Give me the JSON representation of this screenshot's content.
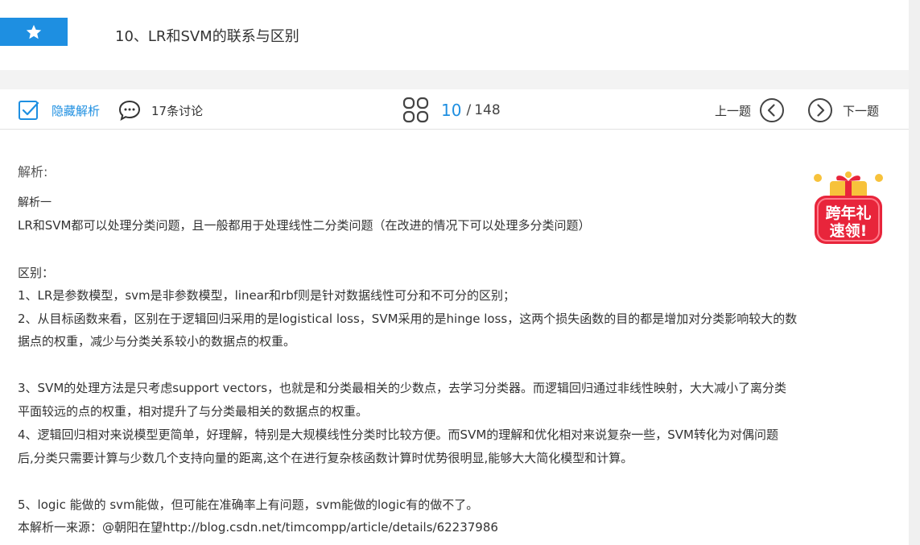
{
  "question": {
    "title": "10、LR和SVM的联系与区别",
    "star_icon": "star-icon"
  },
  "toolbar": {
    "hide_analysis_label": "隐藏解析",
    "discussion_label": "17条讨论",
    "current_page": "10",
    "separator": "/",
    "total_pages": "148",
    "prev_label": "上一题",
    "next_label": "下一题"
  },
  "analysis": {
    "title": "解析:",
    "sub_title": "解析一",
    "lines": [
      "LR和SVM都可以处理分类问题，且一般都用于处理线性二分类问题（在改进的情况下可以处理多分类问题）",
      "区别：",
      "1、LR是参数模型，svm是非参数模型，linear和rbf则是针对数据线性可分和不可分的区别；",
      "2、从目标函数来看，区别在于逻辑回归采用的是logistical loss，SVM采用的是hinge loss，这两个损失函数的目的都是增加对分类影响较大的数",
      "据点的权重，减少与分类关系较小的数据点的权重。",
      "3、SVM的处理方法是只考虑support vectors，也就是和分类最相关的少数点，去学习分类器。而逻辑回归通过非线性映射，大大减小了离分类",
      "平面较远的点的权重，相对提升了与分类最相关的数据点的权重。",
      "4、逻辑回归相对来说模型更简单，好理解，特别是大规模线性分类时比较方便。而SVM的理解和优化相对来说复杂一些，SVM转化为对偶问题",
      "后,分类只需要计算与少数几个支持向量的距离,这个在进行复杂核函数计算时优势很明显,能够大大简化模型和计算。",
      "5、logic 能做的 svm能做，但可能在准确率上有问题，svm能做的logic有的做不了。",
      "本解析一来源：@朝阳在望http://blog.csdn.net/timcompp/article/details/62237986"
    ]
  },
  "promo": {
    "line1": "跨年礼",
    "line2": "速领!"
  },
  "colors": {
    "accent": "#1e8fe1",
    "promo_red": "#e8253b",
    "promo_gold": "#f7c23b"
  }
}
